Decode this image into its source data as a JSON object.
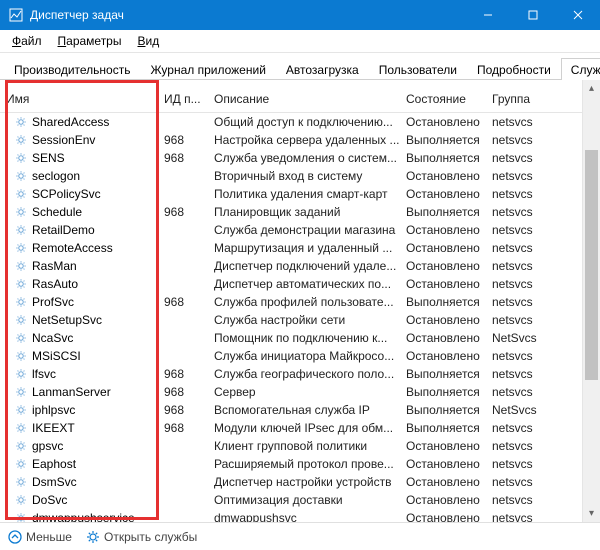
{
  "window": {
    "title": "Диспетчер задач"
  },
  "menus": {
    "file": "Файл",
    "options": "Параметры",
    "view": "Вид"
  },
  "tabs": [
    {
      "id": "perf",
      "label": "Производительность"
    },
    {
      "id": "apphist",
      "label": "Журнал приложений"
    },
    {
      "id": "startup",
      "label": "Автозагрузка"
    },
    {
      "id": "users",
      "label": "Пользователи"
    },
    {
      "id": "details",
      "label": "Подробности"
    },
    {
      "id": "services",
      "label": "Службы",
      "active": true
    }
  ],
  "columns": {
    "name": "Имя",
    "pid": "ИД п...",
    "desc": "Описание",
    "state": "Состояние",
    "group": "Группа"
  },
  "states": {
    "running": "Выполняется",
    "stopped": "Остановлено"
  },
  "services": [
    {
      "name": "SharedAccess",
      "pid": "",
      "desc": "Общий доступ к подключению...",
      "state": "stopped",
      "group": "netsvcs"
    },
    {
      "name": "SessionEnv",
      "pid": "968",
      "desc": "Настройка сервера удаленных ...",
      "state": "running",
      "group": "netsvcs"
    },
    {
      "name": "SENS",
      "pid": "968",
      "desc": "Служба уведомления о систем...",
      "state": "running",
      "group": "netsvcs"
    },
    {
      "name": "seclogon",
      "pid": "",
      "desc": "Вторичный вход в систему",
      "state": "stopped",
      "group": "netsvcs"
    },
    {
      "name": "SCPolicySvc",
      "pid": "",
      "desc": "Политика удаления смарт-карт",
      "state": "stopped",
      "group": "netsvcs"
    },
    {
      "name": "Schedule",
      "pid": "968",
      "desc": "Планировщик заданий",
      "state": "running",
      "group": "netsvcs"
    },
    {
      "name": "RetailDemo",
      "pid": "",
      "desc": "Служба демонстрации магазина",
      "state": "stopped",
      "group": "netsvcs"
    },
    {
      "name": "RemoteAccess",
      "pid": "",
      "desc": "Маршрутизация и удаленный ...",
      "state": "stopped",
      "group": "netsvcs"
    },
    {
      "name": "RasMan",
      "pid": "",
      "desc": "Диспетчер подключений удале...",
      "state": "stopped",
      "group": "netsvcs"
    },
    {
      "name": "RasAuto",
      "pid": "",
      "desc": "Диспетчер автоматических по...",
      "state": "stopped",
      "group": "netsvcs"
    },
    {
      "name": "ProfSvc",
      "pid": "968",
      "desc": "Служба профилей пользовате...",
      "state": "running",
      "group": "netsvcs"
    },
    {
      "name": "NetSetupSvc",
      "pid": "",
      "desc": "Служба настройки сети",
      "state": "stopped",
      "group": "netsvcs"
    },
    {
      "name": "NcaSvc",
      "pid": "",
      "desc": "Помощник по подключению к...",
      "state": "stopped",
      "group": "NetSvcs"
    },
    {
      "name": "MSiSCSI",
      "pid": "",
      "desc": "Служба инициатора Майкросо...",
      "state": "stopped",
      "group": "netsvcs"
    },
    {
      "name": "lfsvc",
      "pid": "968",
      "desc": "Служба географического поло...",
      "state": "running",
      "group": "netsvcs"
    },
    {
      "name": "LanmanServer",
      "pid": "968",
      "desc": "Сервер",
      "state": "running",
      "group": "netsvcs"
    },
    {
      "name": "iphlpsvc",
      "pid": "968",
      "desc": "Вспомогательная служба IP",
      "state": "running",
      "group": "NetSvcs"
    },
    {
      "name": "IKEEXT",
      "pid": "968",
      "desc": "Модули ключей IPsec для обм...",
      "state": "running",
      "group": "netsvcs"
    },
    {
      "name": "gpsvc",
      "pid": "",
      "desc": "Клиент групповой политики",
      "state": "stopped",
      "group": "netsvcs"
    },
    {
      "name": "Eaphost",
      "pid": "",
      "desc": "Расширяемый протокол прове...",
      "state": "stopped",
      "group": "netsvcs"
    },
    {
      "name": "DsmSvc",
      "pid": "",
      "desc": "Диспетчер настройки устройств",
      "state": "stopped",
      "group": "netsvcs"
    },
    {
      "name": "DoSvc",
      "pid": "",
      "desc": "Оптимизация доставки",
      "state": "stopped",
      "group": "netsvcs"
    },
    {
      "name": "dmwappushservice",
      "pid": "",
      "desc": "dmwappushsvc",
      "state": "stopped",
      "group": "netsvcs"
    }
  ],
  "footer": {
    "fewer": "Меньше",
    "open_services": "Открыть службы"
  }
}
